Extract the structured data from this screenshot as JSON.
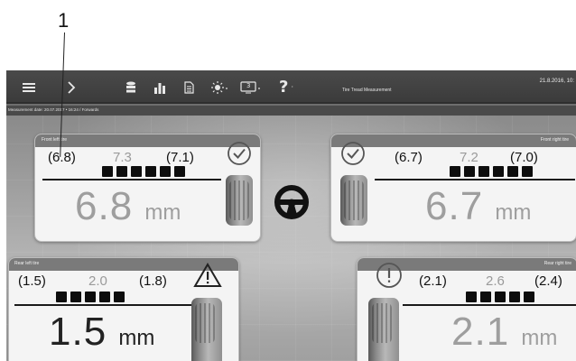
{
  "callout": {
    "number": "1"
  },
  "toolbar": {
    "icons": [
      "menu-icon",
      "forward-icon",
      "database-icon",
      "bar-chart-icon",
      "document-icon",
      "brightness-icon",
      "display-select-icon",
      "help-icon"
    ],
    "display_number": "3",
    "help_glyph": "?",
    "title": "Tire Tread Measurement",
    "date": "21.8.2016, 10:"
  },
  "status": {
    "measurement_date": "Measurement date: 20.07.2017 • 16:24 / Forwards"
  },
  "tires": {
    "front_left": {
      "title": "Front left tire",
      "left": "(6.8)",
      "mid": "7.3",
      "right": "(7.1)",
      "big": "6.8",
      "unit": "mm",
      "blocks": 6,
      "status_icon": "check-circle-icon"
    },
    "front_right": {
      "title": "Front right tire",
      "left": "(6.7)",
      "mid": "7.2",
      "right": "(7.0)",
      "big": "6.7",
      "unit": "mm",
      "blocks": 6,
      "status_icon": "check-circle-icon"
    },
    "rear_left": {
      "title": "Rear left tire",
      "left": "(1.5)",
      "mid": "2.0",
      "right": "(1.8)",
      "big": "1.5",
      "unit": "mm",
      "blocks": 5,
      "status_icon": "warning-triangle-icon"
    },
    "rear_right": {
      "title": "Rear right tire",
      "left": "(2.1)",
      "mid": "2.6",
      "right": "(2.4)",
      "big": "2.1",
      "unit": "mm",
      "blocks": 5,
      "status_icon": "exclamation-circle-icon"
    }
  },
  "center_icon": "steering-wheel-icon",
  "colors": {
    "toolbar": "#3f3f3f",
    "card": "#f4f4f4",
    "header": "#7a7a7a"
  }
}
